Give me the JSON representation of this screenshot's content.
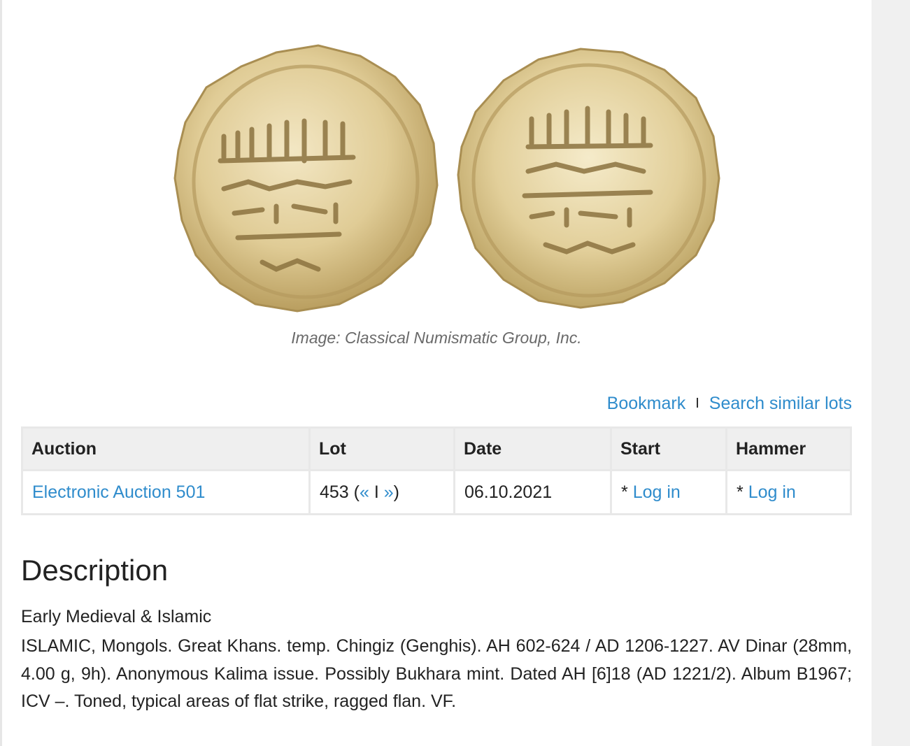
{
  "image": {
    "obverse_icon": "coin-obverse-icon",
    "reverse_icon": "coin-reverse-icon",
    "caption": "Image: Classical Numismatic Group, Inc."
  },
  "actions": {
    "bookmark": "Bookmark",
    "separator": "I",
    "search_similar": "Search similar lots"
  },
  "table": {
    "headers": {
      "auction": "Auction",
      "lot": "Lot",
      "date": "Date",
      "start": "Start",
      "hammer": "Hammer"
    },
    "row": {
      "auction": "Electronic Auction 501",
      "lot_number": "453",
      "lot_open": "(",
      "lot_prev": "«",
      "lot_sep": "I",
      "lot_next": "»",
      "lot_close": ")",
      "date": "06.10.2021",
      "start_prefix": "*",
      "start_link": "Log in",
      "hammer_prefix": "*",
      "hammer_link": "Log in"
    }
  },
  "description": {
    "title": "Description",
    "category": "Early Medieval & Islamic",
    "body": "ISLAMIC, Mongols. Great Khans. temp. Chingiz (Genghis). AH 602-624 / AD 1206-1227. AV Dinar (28mm, 4.00 g, 9h). Anonymous Kalima issue. Possibly Bukhara mint. Dated AH [6]18 (AD 1221/2). Album B1967; ICV –. Toned, typical areas of flat strike, ragged flan. VF."
  },
  "colors": {
    "link": "#2f8ccc",
    "table_header_bg": "#efefef",
    "table_border": "#e8e8e8",
    "gutter": "#f0f0f0",
    "coin_gold": "#e2cf9a"
  }
}
